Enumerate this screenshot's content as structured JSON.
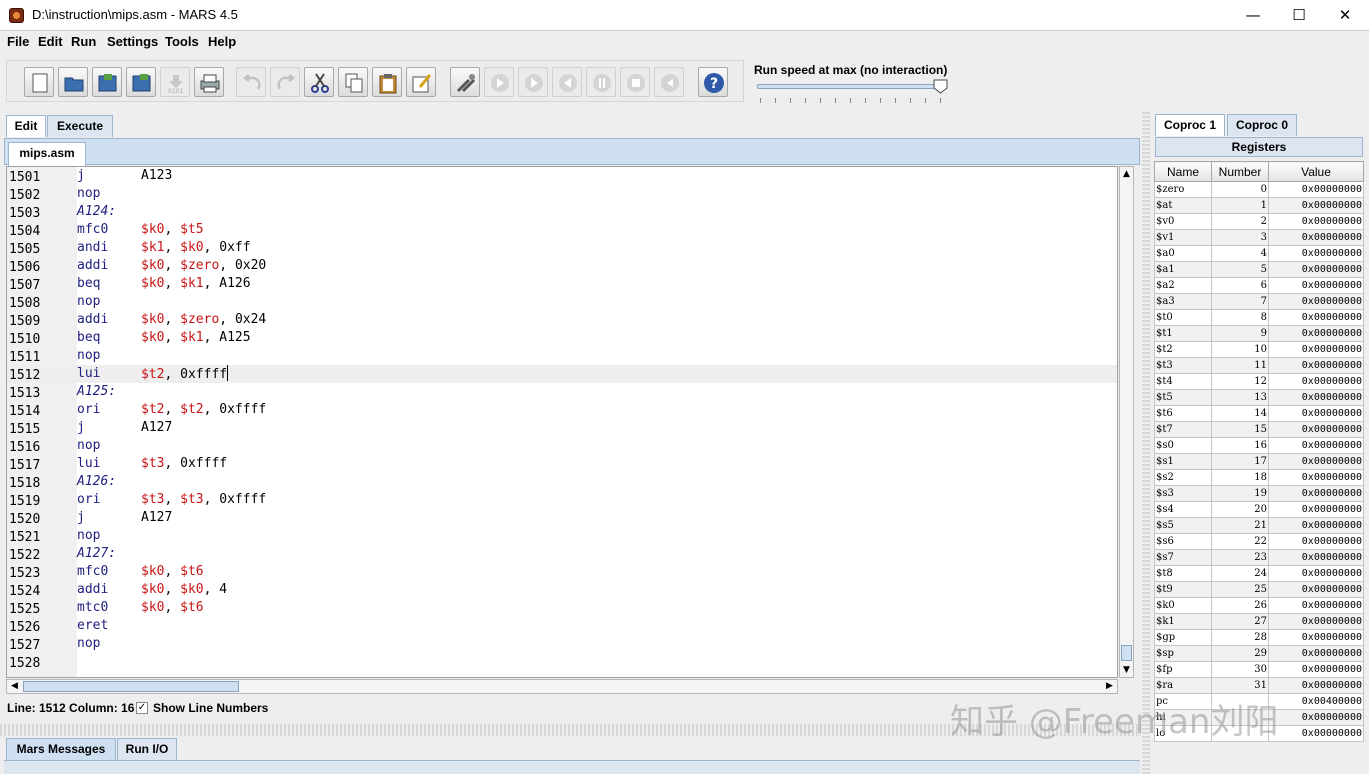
{
  "window": {
    "title": "D:\\instruction\\mips.asm  - MARS 4.5"
  },
  "menu": [
    "File",
    "Edit",
    "Run",
    "Settings",
    "Tools",
    "Help"
  ],
  "toolbar": {
    "speed_label": "Run speed at max (no interaction)",
    "speed_level": 1.0
  },
  "tabs": {
    "edit": "Edit",
    "execute": "Execute",
    "file": "mips.asm"
  },
  "code": [
    {
      "ln": "1501",
      "op": "j",
      "args": [
        [
          "A123",
          "t"
        ]
      ]
    },
    {
      "ln": "1502",
      "op": "nop",
      "args": []
    },
    {
      "ln": "1503",
      "label": "A124:"
    },
    {
      "ln": "1504",
      "op": "mfc0",
      "args": [
        [
          "$k0",
          "r"
        ],
        [
          ", ",
          "t"
        ],
        [
          "$t5",
          "r"
        ]
      ]
    },
    {
      "ln": "1505",
      "op": "andi",
      "args": [
        [
          "$k1",
          "r"
        ],
        [
          ", ",
          "t"
        ],
        [
          "$k0",
          "r"
        ],
        [
          ", ",
          "t"
        ],
        [
          "0xff",
          "t"
        ]
      ]
    },
    {
      "ln": "1506",
      "op": "addi",
      "args": [
        [
          "$k0",
          "r"
        ],
        [
          ", ",
          "t"
        ],
        [
          "$zero",
          "r"
        ],
        [
          ", ",
          "t"
        ],
        [
          "0x20",
          "t"
        ]
      ]
    },
    {
      "ln": "1507",
      "op": "beq",
      "args": [
        [
          "$k0",
          "r"
        ],
        [
          ", ",
          "t"
        ],
        [
          "$k1",
          "r"
        ],
        [
          ", ",
          "t"
        ],
        [
          "A126",
          "t"
        ]
      ]
    },
    {
      "ln": "1508",
      "op": "nop",
      "args": []
    },
    {
      "ln": "1509",
      "op": "addi",
      "args": [
        [
          "$k0",
          "r"
        ],
        [
          ", ",
          "t"
        ],
        [
          "$zero",
          "r"
        ],
        [
          ", ",
          "t"
        ],
        [
          "0x24",
          "t"
        ]
      ]
    },
    {
      "ln": "1510",
      "op": "beq",
      "args": [
        [
          "$k0",
          "r"
        ],
        [
          ", ",
          "t"
        ],
        [
          "$k1",
          "r"
        ],
        [
          ", ",
          "t"
        ],
        [
          "A125",
          "t"
        ]
      ]
    },
    {
      "ln": "1511",
      "op": "nop",
      "args": []
    },
    {
      "ln": "1512",
      "op": "lui",
      "args": [
        [
          "$t2",
          "r"
        ],
        [
          ", ",
          "t"
        ],
        [
          "0xffff",
          "t"
        ]
      ],
      "current": true
    },
    {
      "ln": "1513",
      "label": "A125:"
    },
    {
      "ln": "1514",
      "op": "ori",
      "args": [
        [
          "$t2",
          "r"
        ],
        [
          ", ",
          "t"
        ],
        [
          "$t2",
          "r"
        ],
        [
          ", ",
          "t"
        ],
        [
          "0xffff",
          "t"
        ]
      ]
    },
    {
      "ln": "1515",
      "op": "j",
      "args": [
        [
          "A127",
          "t"
        ]
      ]
    },
    {
      "ln": "1516",
      "op": "nop",
      "args": []
    },
    {
      "ln": "1517",
      "op": "lui",
      "args": [
        [
          "$t3",
          "r"
        ],
        [
          ", ",
          "t"
        ],
        [
          "0xffff",
          "t"
        ]
      ]
    },
    {
      "ln": "1518",
      "label": "A126:"
    },
    {
      "ln": "1519",
      "op": "ori",
      "args": [
        [
          "$t3",
          "r"
        ],
        [
          ", ",
          "t"
        ],
        [
          "$t3",
          "r"
        ],
        [
          ", ",
          "t"
        ],
        [
          "0xffff",
          "t"
        ]
      ]
    },
    {
      "ln": "1520",
      "op": "j",
      "args": [
        [
          "A127",
          "t"
        ]
      ]
    },
    {
      "ln": "1521",
      "op": "nop",
      "args": []
    },
    {
      "ln": "1522",
      "label": "A127:"
    },
    {
      "ln": "1523",
      "op": "mfc0",
      "args": [
        [
          "$k0",
          "r"
        ],
        [
          ", ",
          "t"
        ],
        [
          "$t6",
          "r"
        ]
      ]
    },
    {
      "ln": "1524",
      "op": "addi",
      "args": [
        [
          "$k0",
          "r"
        ],
        [
          ", ",
          "t"
        ],
        [
          "$k0",
          "r"
        ],
        [
          ", ",
          "t"
        ],
        [
          "4",
          "t"
        ]
      ]
    },
    {
      "ln": "1525",
      "op": "mtc0",
      "args": [
        [
          "$k0",
          "r"
        ],
        [
          ", ",
          "t"
        ],
        [
          "$t6",
          "r"
        ]
      ]
    },
    {
      "ln": "1526",
      "op": "eret",
      "args": []
    },
    {
      "ln": "1527",
      "op": "nop",
      "args": []
    },
    {
      "ln": "1528",
      "op": "",
      "args": []
    }
  ],
  "status": {
    "position": "Line: 1512 Column: 16",
    "show_line_numbers": "Show Line Numbers",
    "checked": true
  },
  "bottom_tabs": {
    "messages": "Mars Messages",
    "runio": "Run I/O"
  },
  "right_tabs": {
    "coproc1": "Coproc 1",
    "coproc0": "Coproc 0"
  },
  "registers": {
    "title": "Registers",
    "headers": [
      "Name",
      "Number",
      "Value"
    ],
    "rows": [
      [
        "$zero",
        "0",
        "0x00000000"
      ],
      [
        "$at",
        "1",
        "0x00000000"
      ],
      [
        "$v0",
        "2",
        "0x00000000"
      ],
      [
        "$v1",
        "3",
        "0x00000000"
      ],
      [
        "$a0",
        "4",
        "0x00000000"
      ],
      [
        "$a1",
        "5",
        "0x00000000"
      ],
      [
        "$a2",
        "6",
        "0x00000000"
      ],
      [
        "$a3",
        "7",
        "0x00000000"
      ],
      [
        "$t0",
        "8",
        "0x00000000"
      ],
      [
        "$t1",
        "9",
        "0x00000000"
      ],
      [
        "$t2",
        "10",
        "0x00000000"
      ],
      [
        "$t3",
        "11",
        "0x00000000"
      ],
      [
        "$t4",
        "12",
        "0x00000000"
      ],
      [
        "$t5",
        "13",
        "0x00000000"
      ],
      [
        "$t6",
        "14",
        "0x00000000"
      ],
      [
        "$t7",
        "15",
        "0x00000000"
      ],
      [
        "$s0",
        "16",
        "0x00000000"
      ],
      [
        "$s1",
        "17",
        "0x00000000"
      ],
      [
        "$s2",
        "18",
        "0x00000000"
      ],
      [
        "$s3",
        "19",
        "0x00000000"
      ],
      [
        "$s4",
        "20",
        "0x00000000"
      ],
      [
        "$s5",
        "21",
        "0x00000000"
      ],
      [
        "$s6",
        "22",
        "0x00000000"
      ],
      [
        "$s7",
        "23",
        "0x00000000"
      ],
      [
        "$t8",
        "24",
        "0x00000000"
      ],
      [
        "$t9",
        "25",
        "0x00000000"
      ],
      [
        "$k0",
        "26",
        "0x00000000"
      ],
      [
        "$k1",
        "27",
        "0x00000000"
      ],
      [
        "$gp",
        "28",
        "0x00000000"
      ],
      [
        "$sp",
        "29",
        "0x00000000"
      ],
      [
        "$fp",
        "30",
        "0x00000000"
      ],
      [
        "$ra",
        "31",
        "0x00000000"
      ],
      [
        "pc",
        "",
        "0x00400000"
      ],
      [
        "hi",
        "",
        "0x00000000"
      ],
      [
        "lo",
        "",
        "0x00000000"
      ]
    ]
  },
  "watermark": "知乎 @Freeman刘阳",
  "colors": {
    "register": "#c81414",
    "mnemonic": "#202080",
    "tab_strip": "#cfe0f3"
  }
}
